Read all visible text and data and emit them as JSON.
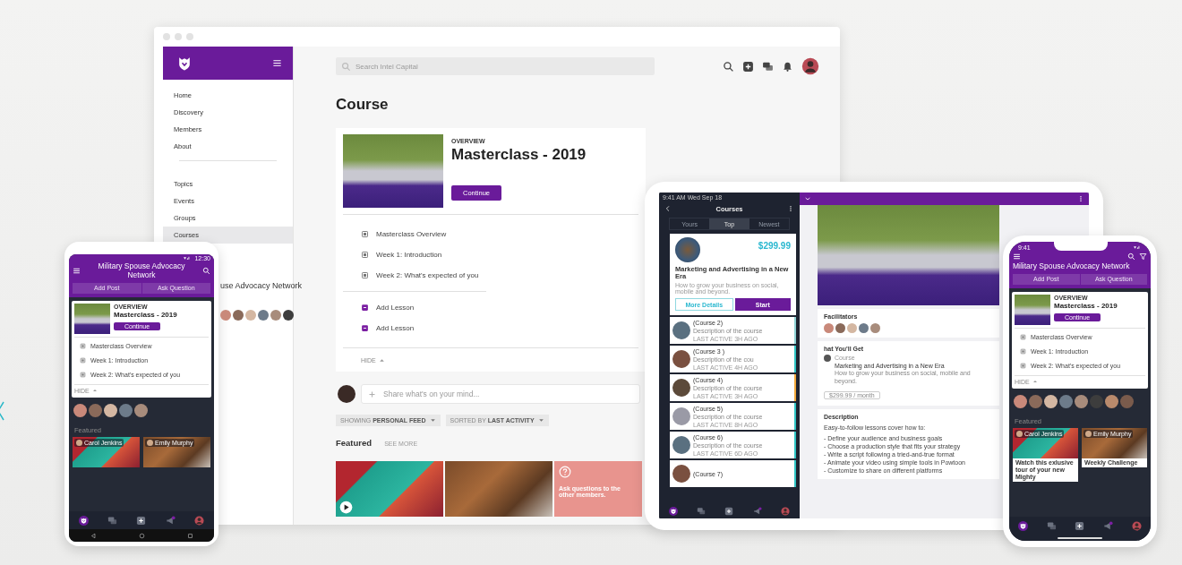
{
  "desktop": {
    "sidebar": {
      "nav": [
        {
          "label": "Home",
          "selected": false
        },
        {
          "label": "Discovery",
          "selected": false
        },
        {
          "label": "Members",
          "selected": false
        },
        {
          "label": "About",
          "selected": false
        }
      ],
      "nav_secondary": [
        {
          "label": "Topics",
          "selected": false
        },
        {
          "label": "Events",
          "selected": false
        },
        {
          "label": "Groups",
          "selected": false
        },
        {
          "label": "Courses",
          "selected": true
        }
      ],
      "community_name": "use Advocacy Network"
    },
    "search": {
      "placeholder": "Search Intel Capital"
    },
    "heading": "Course",
    "course": {
      "eyebrow": "OVERVIEW",
      "title": "Masterclass - 2019",
      "button": "Continue",
      "lessons": [
        {
          "label": "Masterclass Overview",
          "kind": "lesson"
        },
        {
          "label": "Week 1: Introduction",
          "kind": "lesson"
        },
        {
          "label": "Week 2: What's expected of you",
          "kind": "lesson"
        },
        {
          "label": "Add Lesson",
          "kind": "add"
        },
        {
          "label": "Add Lesson",
          "kind": "add"
        }
      ],
      "hide": "HIDE"
    },
    "composer": {
      "placeholder": "Share what's on your mind..."
    },
    "filters": [
      {
        "label": "SHOWING **PERSONAL FEED**"
      },
      {
        "label": "SORTED BY **LAST ACTIVITY**"
      }
    ],
    "featured": {
      "title": "Featured",
      "link": "SEE MORE",
      "tiles": [
        {
          "kind": "video"
        },
        {
          "kind": "photo"
        },
        {
          "kind": "prompt",
          "text": "Ask questions to the other members."
        }
      ]
    }
  },
  "android_phone": {
    "status_time": "12:30",
    "title": "Military Spouse Advocacy Network",
    "tabs": [
      {
        "label": "Add Post"
      },
      {
        "label": "Ask Question"
      }
    ],
    "course": {
      "eyebrow": "OVERVIEW",
      "title": "Masterclass - 2019",
      "button": "Continue",
      "lessons": [
        {
          "label": "Masterclass Overview"
        },
        {
          "label": "Week 1: Introduction"
        },
        {
          "label": "Week 2: What's expected of you"
        }
      ],
      "hide": "HIDE"
    },
    "featured": {
      "title": "Featured",
      "tiles": [
        {
          "author": "Carol Jenkins"
        },
        {
          "author": "Emily Murphy"
        }
      ]
    }
  },
  "tablet": {
    "status": "9:41 AM  Wed Sep 18",
    "title": "Courses",
    "segments": [
      {
        "label": "Yours",
        "selected": false
      },
      {
        "label": "Top",
        "selected": true
      },
      {
        "label": "Newest",
        "selected": false
      }
    ],
    "featured_course": {
      "price": "$299.99",
      "title": "Marketing and Advertising in a New Era",
      "description": "How to grow your business on social, mobile and beyond.",
      "buttons": [
        {
          "label": "More Details",
          "kind": "outline"
        },
        {
          "label": "Start",
          "kind": "primary"
        }
      ]
    },
    "courses": [
      {
        "title": "(Course 2)",
        "description": "Description of the course",
        "activity": "LAST ACTIVE 3H AGO",
        "color": "#8fd3d6"
      },
      {
        "title": "(Course 3 )",
        "description": "Description of the cou",
        "activity": "LAST ACTIVE 4H AGO",
        "color": "#2ec4c4"
      },
      {
        "title": "(Course 4)",
        "description": "Description of the course",
        "activity": "LAST ACTIVE 3H AGO",
        "color": "#f2a93b"
      },
      {
        "title": "(Course 5)",
        "description": "Description of the course",
        "activity": "LAST ACTIVE 8H AGO",
        "color": "#2ec4c4"
      },
      {
        "title": "(Course 6)",
        "description": "Description of the course",
        "activity": "LAST ACTIVE 6D AGO",
        "color": "#2ec4c4"
      },
      {
        "title": "(Course 7)",
        "color": "#2ec4c4"
      }
    ],
    "detail": {
      "facilitators": "Facilitators",
      "offer": {
        "title": "hat You'll Get",
        "label": "Course",
        "name": "Marketing and Advertising in a New Era",
        "description": "How to grow your business on social, mobile and beyond.",
        "price": "$299.99 / month"
      },
      "description": {
        "title": "Description",
        "intro": "Easy-to-follow lessons cover how to:",
        "points": [
          "- Define your audience and business goals",
          "- Choose a production style that fits your strategy",
          "- Write a script following a tried-and-true format",
          "- Animate your video using simple tools in Powtoon",
          "- Customize to share on different platforms"
        ]
      }
    }
  },
  "iphone": {
    "status_time": "9:41",
    "title": "Military Spouse Advocacy Network",
    "tabs": [
      {
        "label": "Add Post"
      },
      {
        "label": "Ask Question"
      }
    ],
    "course": {
      "eyebrow": "OVERVIEW",
      "title": "Masterclass - 2019",
      "button": "Continue",
      "lessons": [
        {
          "label": "Masterclass Overview"
        },
        {
          "label": "Week 1: Introduction"
        },
        {
          "label": "Week 2: What's expected of you"
        }
      ],
      "hide": "HIDE"
    },
    "featured": {
      "title": "Featured",
      "tiles": [
        {
          "author": "Carol Jenkins",
          "caption": "Watch this exlusive tour of your new Mighty"
        },
        {
          "author": "Emily Murphy",
          "caption": "Weekly Challenge"
        }
      ]
    }
  }
}
